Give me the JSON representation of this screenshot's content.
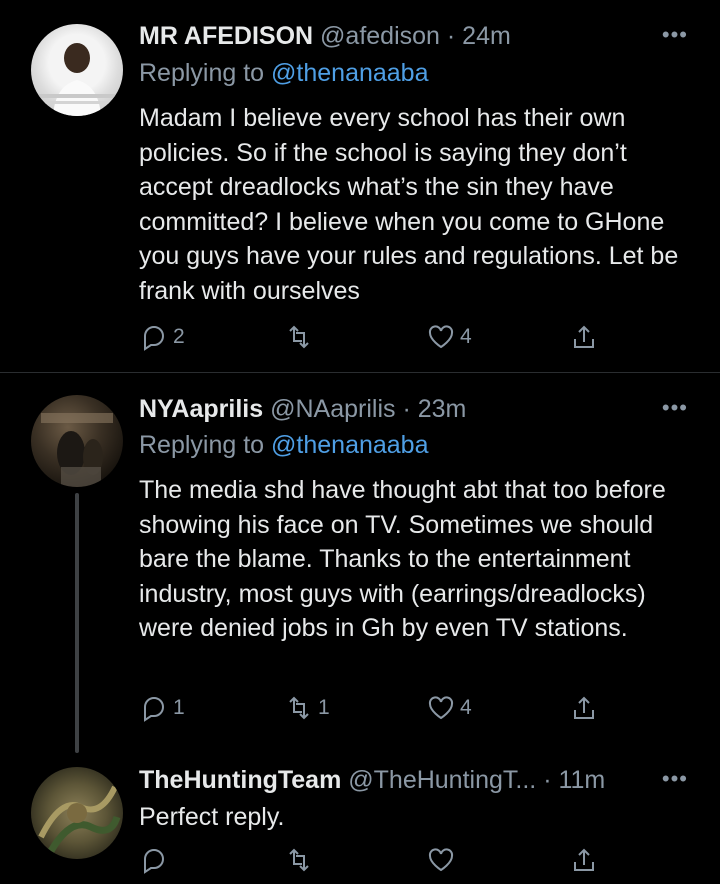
{
  "tweets": [
    {
      "name": "MR AFEDISON",
      "handle": "@afedison",
      "time": "· 24m",
      "replying_prefix": "Replying to",
      "replying_to": "@thenanaaba",
      "text": "Madam I believe every school has their own policies. So if the school is saying they don’t accept dreadlocks what’s the sin they have committed? I believe when you come to GHone you guys have your rules and regulations. Let be frank with ourselves",
      "replies": "2",
      "retweets": "",
      "likes": "4"
    },
    {
      "name": "NYAaprilis",
      "handle": "@NAaprilis",
      "time": "· 23m",
      "replying_prefix": "Replying to",
      "replying_to": "@thenanaaba",
      "text": "The media shd have thought abt that too before showing his face on TV. Sometimes we should bare the blame. Thanks to the entertainment industry, most guys with (earrings/dreadlocks) were denied jobs in Gh by even TV stations.",
      "replies": "1",
      "retweets": "1",
      "likes": "4"
    },
    {
      "name": "TheHuntingTeam",
      "handle": "@TheHuntingT...",
      "time": "· 11m",
      "text": "Perfect reply.",
      "replies": "",
      "retweets": "",
      "likes": ""
    }
  ],
  "more_icon": "more-horizontal-icon",
  "colors": {
    "background": "#000000",
    "text": "#e7e9ea",
    "muted": "#8b98a5",
    "link": "#4f9fe5"
  }
}
